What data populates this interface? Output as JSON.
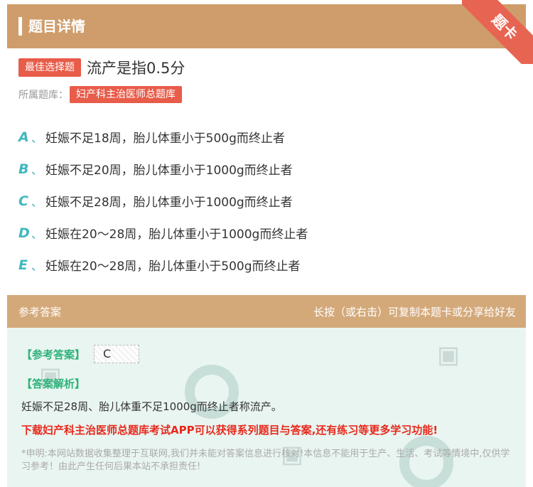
{
  "header": {
    "title": "题目详情",
    "ribbon": "题卡"
  },
  "question": {
    "type_badge": "最佳选择题",
    "text": "流产是指0.5分",
    "bank_label": "所属题库：",
    "bank_name": "妇产科主治医师总题库"
  },
  "options": [
    {
      "letter": "A",
      "sep": "、",
      "text": "妊娠不足18周，胎儿体重小于500g而终止者"
    },
    {
      "letter": "B",
      "sep": "、",
      "text": "妊娠不足20周，胎儿体重小于1000g而终止者"
    },
    {
      "letter": "C",
      "sep": "、",
      "text": "妊娠不足28周，胎儿体重小于1000g而终止者"
    },
    {
      "letter": "D",
      "sep": "、",
      "text": "妊娠在20～28周，胎儿体重小于1000g而终止者"
    },
    {
      "letter": "E",
      "sep": "、",
      "text": "妊娠在20～28周，胎儿体重小于500g而终止者"
    }
  ],
  "answer_section": {
    "title": "参考答案",
    "hint": "长按（或右击）可复制本题卡或分享给好友",
    "answer_tag": "【参考答案】",
    "answer_value": "C",
    "analysis_tag": "【答案解析】",
    "analysis_text": "妊娠不足28周、胎儿体重不足1000g而终止者称流产。",
    "download_text": "下载妇产科主治医师总题库考试APP可以获得系列题目与答案,还有练习等更多学习功能!",
    "disclaimer": "*申明:本网站数据收集整理于互联网,我们并未能对答案信息进行核对!本信息不能用于生产、生活、考试等情境中,仅供学习参考！由此产生任何后果本站不承担责任!"
  },
  "colors": {
    "header_bg": "#cf9d6b",
    "badge_red": "#e85c4a",
    "option_teal": "#3fb8bf",
    "answer_green": "#2db37a",
    "download_red": "#e8291c"
  }
}
